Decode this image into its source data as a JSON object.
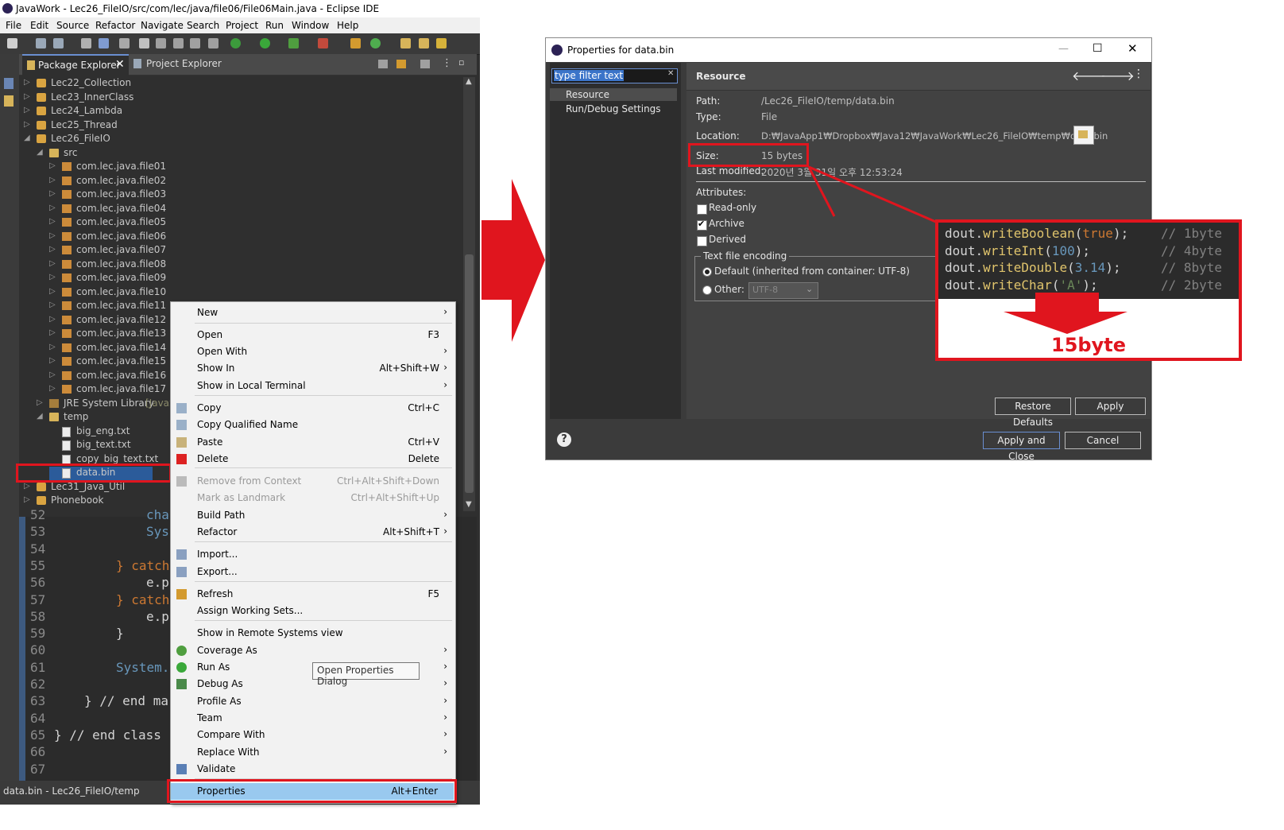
{
  "eclipse": {
    "window_title": "JavaWork - Lec26_FileIO/src/com/lec/java/file06/File06Main.java - Eclipse IDE",
    "menu": [
      "File",
      "Edit",
      "Source",
      "Refactor",
      "Navigate",
      "Search",
      "Project",
      "Run",
      "Window",
      "Help"
    ],
    "tabs": {
      "package_explorer": "Package Explorer",
      "project_explorer": "Project Explorer"
    },
    "tree": [
      {
        "label": "Lec22_Collection",
        "icon": "project-icon"
      },
      {
        "label": "Lec23_InnerClass",
        "icon": "project-icon"
      },
      {
        "label": "Lec24_Lambda",
        "icon": "project-icon"
      },
      {
        "label": "Lec25_Thread",
        "icon": "project-icon"
      },
      {
        "label": "Lec26_FileIO",
        "icon": "project-icon"
      },
      {
        "label": "src",
        "icon": "source-folder-icon"
      },
      {
        "label": "com.lec.java.file01",
        "icon": "package-icon"
      },
      {
        "label": "com.lec.java.file02",
        "icon": "package-icon"
      },
      {
        "label": "com.lec.java.file03",
        "icon": "package-icon"
      },
      {
        "label": "com.lec.java.file04",
        "icon": "package-icon"
      },
      {
        "label": "com.lec.java.file05",
        "icon": "package-icon"
      },
      {
        "label": "com.lec.java.file06",
        "icon": "package-icon"
      },
      {
        "label": "com.lec.java.file07",
        "icon": "package-icon"
      },
      {
        "label": "com.lec.java.file08",
        "icon": "package-icon"
      },
      {
        "label": "com.lec.java.file09",
        "icon": "package-icon"
      },
      {
        "label": "com.lec.java.file10",
        "icon": "package-icon"
      },
      {
        "label": "com.lec.java.file11",
        "icon": "package-icon"
      },
      {
        "label": "com.lec.java.file12",
        "icon": "package-icon"
      },
      {
        "label": "com.lec.java.file13",
        "icon": "package-icon"
      },
      {
        "label": "com.lec.java.file14",
        "icon": "package-icon"
      },
      {
        "label": "com.lec.java.file15",
        "icon": "package-icon"
      },
      {
        "label": "com.lec.java.file16",
        "icon": "package-icon"
      },
      {
        "label": "com.lec.java.file17",
        "icon": "package-icon"
      },
      {
        "label": "JRE System Library",
        "suffix": "[JavaSE",
        "icon": "library-icon"
      },
      {
        "label": "temp",
        "icon": "folder-icon"
      },
      {
        "label": "big_eng.txt",
        "icon": "file-icon"
      },
      {
        "label": "big_text.txt",
        "icon": "file-icon"
      },
      {
        "label": "copy_big_text.txt",
        "icon": "file-icon"
      },
      {
        "label": "data.bin",
        "icon": "file-icon"
      },
      {
        "label": "Lec31_Java_Util",
        "icon": "project-icon"
      },
      {
        "label": "Phonebook",
        "icon": "project-icon"
      }
    ],
    "editor_lines": [
      {
        "no": "52",
        "code": "cha"
      },
      {
        "no": "53",
        "code": "Sys"
      },
      {
        "no": "54",
        "code": ""
      },
      {
        "no": "55",
        "code": "} catch"
      },
      {
        "no": "56",
        "code": "e.p"
      },
      {
        "no": "57",
        "code": "} catch"
      },
      {
        "no": "58",
        "code": "e.p"
      },
      {
        "no": "59",
        "code": "}"
      },
      {
        "no": "60",
        "code": ""
      },
      {
        "no": "61",
        "code": "System."
      },
      {
        "no": "62",
        "code": ""
      },
      {
        "no": "63",
        "code": "} // end ma"
      },
      {
        "no": "64",
        "code": ""
      },
      {
        "no": "65",
        "code": "} // end class"
      },
      {
        "no": "66",
        "code": ""
      },
      {
        "no": "67",
        "code": ""
      }
    ],
    "status": "data.bin - Lec26_FileIO/temp"
  },
  "context_menu": {
    "items": [
      {
        "label": "New",
        "shortcut": "",
        "submenu": true
      },
      {
        "label": "Open",
        "shortcut": "F3"
      },
      {
        "label": "Open With",
        "shortcut": "",
        "submenu": true
      },
      {
        "label": "Show In",
        "shortcut": "Alt+Shift+W",
        "submenu": true
      },
      {
        "label": "Show in Local Terminal",
        "shortcut": "",
        "submenu": true
      },
      {
        "label": "Copy",
        "shortcut": "Ctrl+C"
      },
      {
        "label": "Copy Qualified Name",
        "shortcut": ""
      },
      {
        "label": "Paste",
        "shortcut": "Ctrl+V"
      },
      {
        "label": "Delete",
        "shortcut": "Delete"
      },
      {
        "label": "Remove from Context",
        "shortcut": "Ctrl+Alt+Shift+Down",
        "disabled": true
      },
      {
        "label": "Mark as Landmark",
        "shortcut": "Ctrl+Alt+Shift+Up",
        "disabled": true
      },
      {
        "label": "Build Path",
        "shortcut": "",
        "submenu": true
      },
      {
        "label": "Refactor",
        "shortcut": "Alt+Shift+T",
        "submenu": true
      },
      {
        "label": "Import...",
        "shortcut": ""
      },
      {
        "label": "Export...",
        "shortcut": ""
      },
      {
        "label": "Refresh",
        "shortcut": "F5"
      },
      {
        "label": "Assign Working Sets...",
        "shortcut": ""
      },
      {
        "label": "Show in Remote Systems view",
        "shortcut": ""
      },
      {
        "label": "Coverage As",
        "shortcut": "",
        "submenu": true
      },
      {
        "label": "Run As",
        "shortcut": "",
        "submenu": true
      },
      {
        "label": "Debug As",
        "shortcut": "",
        "submenu": true
      },
      {
        "label": "Profile As",
        "shortcut": "",
        "submenu": true
      },
      {
        "label": "Team",
        "shortcut": "",
        "submenu": true
      },
      {
        "label": "Compare With",
        "shortcut": "",
        "submenu": true
      },
      {
        "label": "Replace With",
        "shortcut": "",
        "submenu": true
      },
      {
        "label": "Validate",
        "shortcut": ""
      },
      {
        "label": "Properties",
        "shortcut": "Alt+Enter"
      }
    ],
    "tooltip": "Open Properties Dialog"
  },
  "dialog": {
    "title": "Properties for data.bin",
    "filter_placeholder": "type filter text",
    "nav": [
      "Resource",
      "Run/Debug Settings"
    ],
    "section_title": "Resource",
    "fields": {
      "path_label": "Path:",
      "path_value": "/Lec26_FileIO/temp/data.bin",
      "type_label": "Type:",
      "type_value": "File",
      "location_label": "Location:",
      "location_value": "D:₩JavaApp1₩Dropbox₩Java12₩JavaWork₩Lec26_FileIO₩temp₩data.bin",
      "size_label": "Size:",
      "size_value": "15  bytes",
      "modified_label": "Last modified:",
      "modified_value": "2020년 3월 31일 오후 12:53:24"
    },
    "attributes_label": "Attributes:",
    "attributes": [
      {
        "label": "Read-only",
        "checked": false
      },
      {
        "label": "Archive",
        "checked": true
      },
      {
        "label": "Derived",
        "checked": false
      }
    ],
    "encoding_group": "Text file encoding",
    "encoding_default": "Default (inherited from container: UTF-8)",
    "encoding_other": "Other:",
    "encoding_other_value": "UTF-8",
    "buttons": {
      "restore": "Restore Defaults",
      "apply": "Apply",
      "apply_close": "Apply and Close",
      "cancel": "Cancel"
    }
  },
  "annotation": {
    "code": [
      {
        "obj": "dout.",
        "method": "writeBoolean",
        "open": "(",
        "arg": "true",
        "close": ");",
        "comment": "// 1byte"
      },
      {
        "obj": "dout.",
        "method": "writeInt",
        "open": "(",
        "arg": "100",
        "close": ");",
        "comment": "// 4byte"
      },
      {
        "obj": "dout.",
        "method": "writeDouble",
        "open": "(",
        "arg": "3.14",
        "close": ");",
        "comment": "// 8byte"
      },
      {
        "obj": "dout.",
        "method": "writeChar",
        "open": "(",
        "arg": "'A'",
        "close": ");",
        "comment": "// 2byte"
      }
    ],
    "result": "15byte",
    "accent": "#e0151e"
  }
}
